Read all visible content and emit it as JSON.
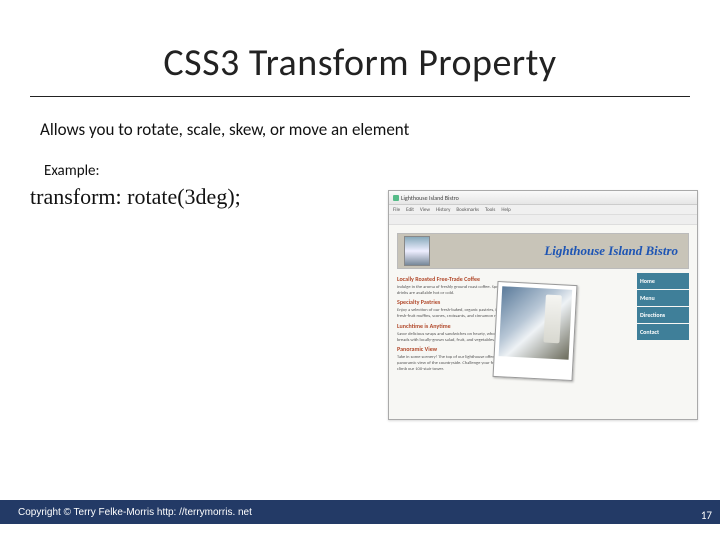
{
  "title": "CSS3 Transform Property",
  "body": "Allows you to rotate, scale, skew, or move an element",
  "exampleLabel": "Example:",
  "code": "transform: rotate(3deg);",
  "screenshot": {
    "windowTitle": "Lighthouse Island Bistro",
    "menubar": [
      "File",
      "Edit",
      "View",
      "History",
      "Bookmarks",
      "Tools",
      "Help"
    ],
    "heading": "Lighthouse Island Bistro",
    "nav": [
      "Home",
      "Menu",
      "Directions",
      "Contact"
    ],
    "sections": {
      "s1": {
        "h": "Locally Roasted Free-Trade Coffee",
        "p": "Indulge in the aroma of freshly ground roast coffee. Specialty drinks are available hot or cold."
      },
      "s2": {
        "h": "Specialty Pastries",
        "p": "Enjoy a selection of our fresh-baked, organic pastries, including fresh-fruit muffins, scones, croissants, and cinnamon rolls."
      },
      "s3": {
        "h": "Lunchtime is Anytime",
        "p": "Savor delicious wraps and sandwiches on hearty, whole-grain breads with locally-grown salad, fruit, and vegetables."
      },
      "s4": {
        "h": "Panoramic View",
        "p": "Take in some scenery! The top of our lighthouse offers a panoramic view of the countryside. Challenge your friends to climb our 100-stair tower."
      }
    }
  },
  "footer": "Copyright © Terry Felke-Morris http: //terrymorris. net",
  "pageNumber": "17"
}
